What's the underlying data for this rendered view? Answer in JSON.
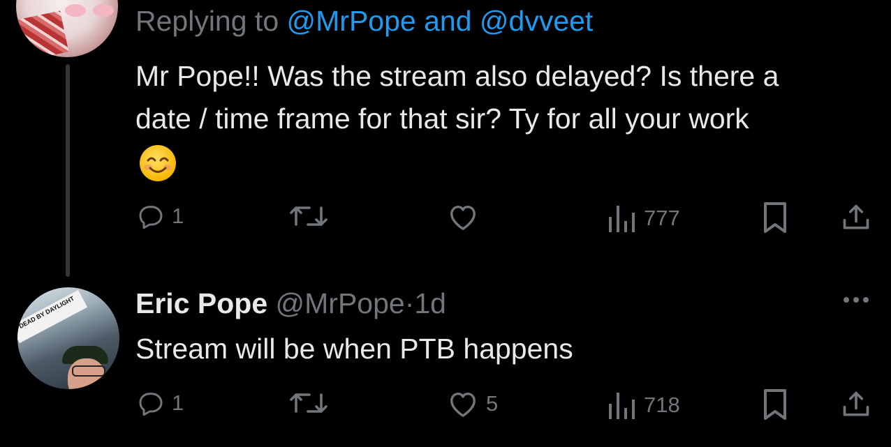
{
  "reply_tweet": {
    "replying_prefix": "Replying to",
    "replying_to_users": "@MrPope and @dvveet",
    "text_line1": "Mr Pope!! Was the stream also delayed? Is there a",
    "text_line2": "date / time frame for that sir? Ty for all your work",
    "emoji": "smiling-face-with-smiling-eyes",
    "actions": {
      "reply_count": "1",
      "views_count": "777"
    }
  },
  "author_reply": {
    "display_name": "Eric Pope",
    "handle": "@MrPope",
    "separator": "·",
    "time_ago": "1d",
    "text": "Stream will be when PTB happens",
    "avatar_banner": "DEAD BY DAYLIGHT",
    "actions": {
      "reply_count": "1",
      "like_count": "5",
      "views_count": "718"
    }
  },
  "colors": {
    "background": "#000000",
    "text": "#e7e9ea",
    "muted": "#71767b",
    "link": "#1d9bf0",
    "thread_line": "#333639"
  },
  "icons": [
    "reply-icon",
    "retweet-icon",
    "like-icon",
    "views-icon",
    "bookmark-icon",
    "share-icon",
    "more-icon"
  ]
}
